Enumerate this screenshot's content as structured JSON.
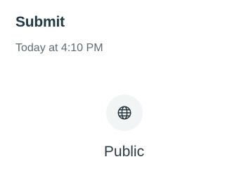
{
  "card": {
    "title": "Submit",
    "timestamp": "Today at 4:10 PM"
  },
  "visibility": {
    "icon": "globe-icon",
    "label": "Public"
  },
  "colors": {
    "title": "#1f3a46",
    "muted": "#5f6d73",
    "icon_bg": "#f2f5f6",
    "icon_stroke": "#22333b"
  }
}
